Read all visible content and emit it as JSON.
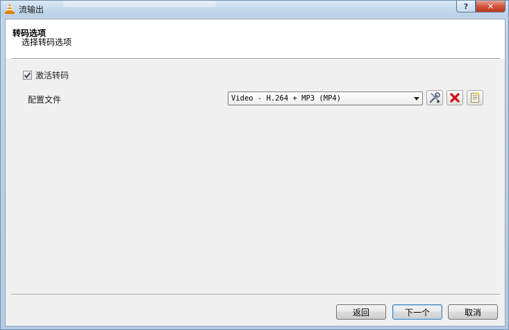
{
  "window": {
    "title": "流输出",
    "help_label": "?",
    "close_label": "✕"
  },
  "header": {
    "title": "转码选项",
    "subtitle": "选择转码选项"
  },
  "transcode": {
    "enable_label": "激活转码",
    "enabled": true
  },
  "profile": {
    "label": "配置文件",
    "selected": "Video - H.264 + MP3 (MP4)"
  },
  "icons": {
    "edit": "wrench-screwdriver-icon",
    "delete": "red-x-icon",
    "new": "new-profile-icon"
  },
  "buttons": {
    "back": "返回",
    "next": "下一个",
    "cancel": "取消"
  },
  "colors": {
    "close_button": "#c1351b",
    "delete_icon": "#d3141a"
  }
}
